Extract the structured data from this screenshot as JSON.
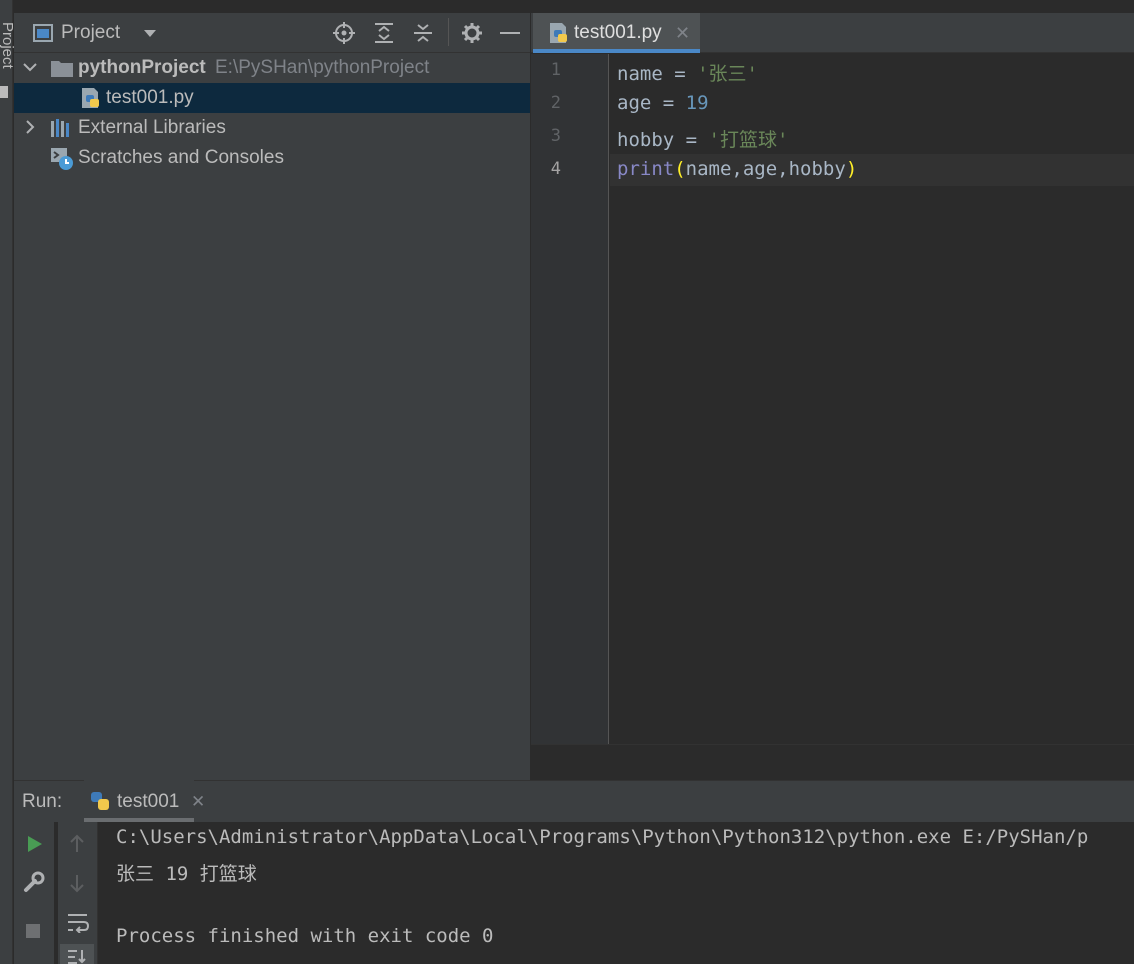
{
  "sidebar_stripe": {
    "label": "Project"
  },
  "project_panel": {
    "title": "Project",
    "tree": {
      "root": {
        "name": "pythonProject",
        "path": "E:\\PySHan\\pythonProject"
      },
      "file": {
        "name": "test001.py"
      },
      "external_libraries": {
        "label": "External Libraries"
      },
      "scratches": {
        "label": "Scratches and Consoles"
      }
    }
  },
  "editor": {
    "tab": {
      "label": "test001.py"
    },
    "line_numbers": [
      "1",
      "2",
      "3",
      "4"
    ],
    "code": {
      "line1": {
        "var": "name",
        "op": " = ",
        "value": "'张三'"
      },
      "line2": {
        "var": "age",
        "op": " = ",
        "value": "19"
      },
      "line3": {
        "var": "hobby",
        "op": " = ",
        "value": "'打篮球'"
      },
      "line4": {
        "func": "print",
        "open": "(",
        "args": "name,age,hobby",
        "close": ")"
      }
    }
  },
  "run_panel": {
    "label": "Run:",
    "tab": {
      "label": "test001"
    },
    "console": {
      "command": "C:\\Users\\Administrator\\AppData\\Local\\Programs\\Python\\Python312\\python.exe E:/PySHan/p",
      "output": "张三 19 打篮球",
      "exit_message": "Process finished with exit code 0"
    }
  },
  "colors": {
    "accent": "#4a88c7",
    "selection": "#0d293e",
    "run_green": "#499c54",
    "string": "#6a8759",
    "number": "#6897bb",
    "builtin": "#8888c6"
  }
}
